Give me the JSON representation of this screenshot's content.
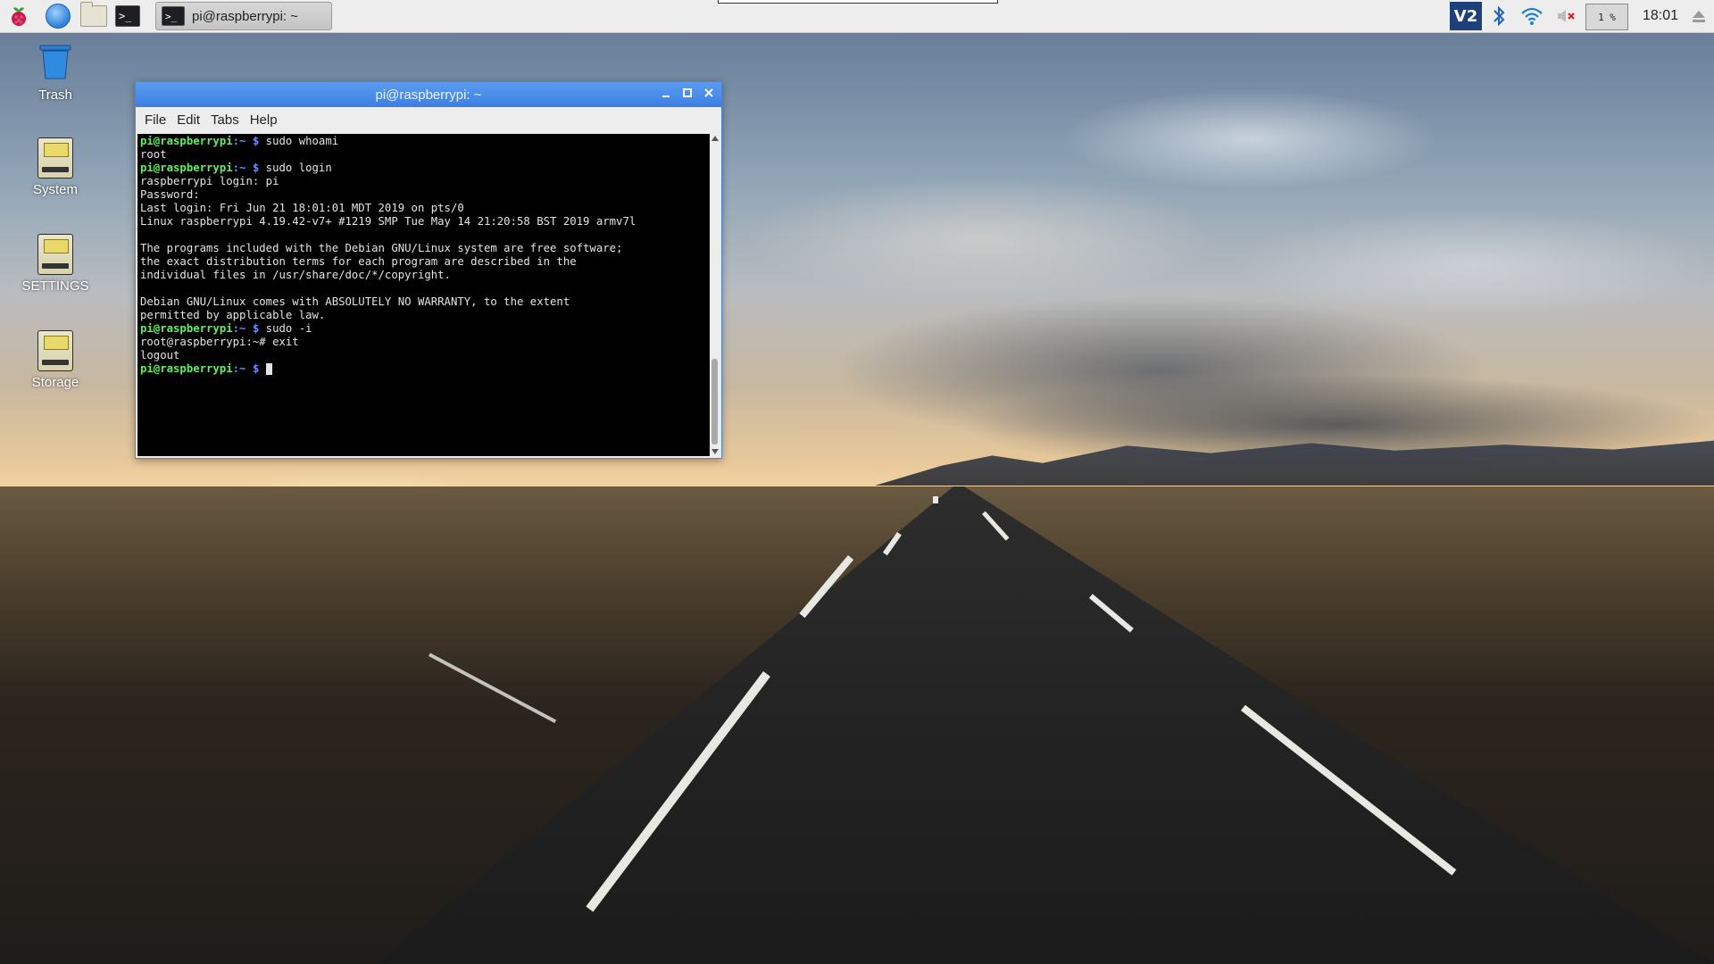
{
  "panel": {
    "task_label": "pi@raspberrypi: ~",
    "vnc_label": "V2",
    "cpu_label": "1 %",
    "clock": "18:01"
  },
  "desktop": {
    "icons": [
      {
        "label": "Trash"
      },
      {
        "label": "System"
      },
      {
        "label": "SETTINGS"
      },
      {
        "label": "Storage"
      }
    ]
  },
  "window": {
    "title": "pi@raspberrypi: ~",
    "menu": [
      "File",
      "Edit",
      "Tabs",
      "Help"
    ]
  },
  "terminal": {
    "prompt_user": "pi@raspberrypi",
    "prompt_path": ":~ $",
    "lines": [
      {
        "type": "prompt",
        "cmd": " sudo whoami"
      },
      {
        "type": "text",
        "text": "root"
      },
      {
        "type": "prompt",
        "cmd": " sudo login"
      },
      {
        "type": "text",
        "text": "raspberrypi login: pi"
      },
      {
        "type": "text",
        "text": "Password:"
      },
      {
        "type": "text",
        "text": "Last login: Fri Jun 21 18:01:01 MDT 2019 on pts/0"
      },
      {
        "type": "text",
        "text": "Linux raspberrypi 4.19.42-v7+ #1219 SMP Tue May 14 21:20:58 BST 2019 armv7l"
      },
      {
        "type": "text",
        "text": ""
      },
      {
        "type": "text",
        "text": "The programs included with the Debian GNU/Linux system are free software;"
      },
      {
        "type": "text",
        "text": "the exact distribution terms for each program are described in the"
      },
      {
        "type": "text",
        "text": "individual files in /usr/share/doc/*/copyright."
      },
      {
        "type": "text",
        "text": ""
      },
      {
        "type": "text",
        "text": "Debian GNU/Linux comes with ABSOLUTELY NO WARRANTY, to the extent"
      },
      {
        "type": "text",
        "text": "permitted by applicable law."
      },
      {
        "type": "prompt",
        "cmd": " sudo -i"
      },
      {
        "type": "text",
        "text": "root@raspberrypi:~# exit"
      },
      {
        "type": "text",
        "text": "logout"
      },
      {
        "type": "prompt",
        "cmd": " ",
        "cursor": true
      }
    ]
  },
  "colors": {
    "titlebar": "#3c80e3",
    "prompt_user": "#5ef05e",
    "prompt_path": "#6d8cff"
  }
}
